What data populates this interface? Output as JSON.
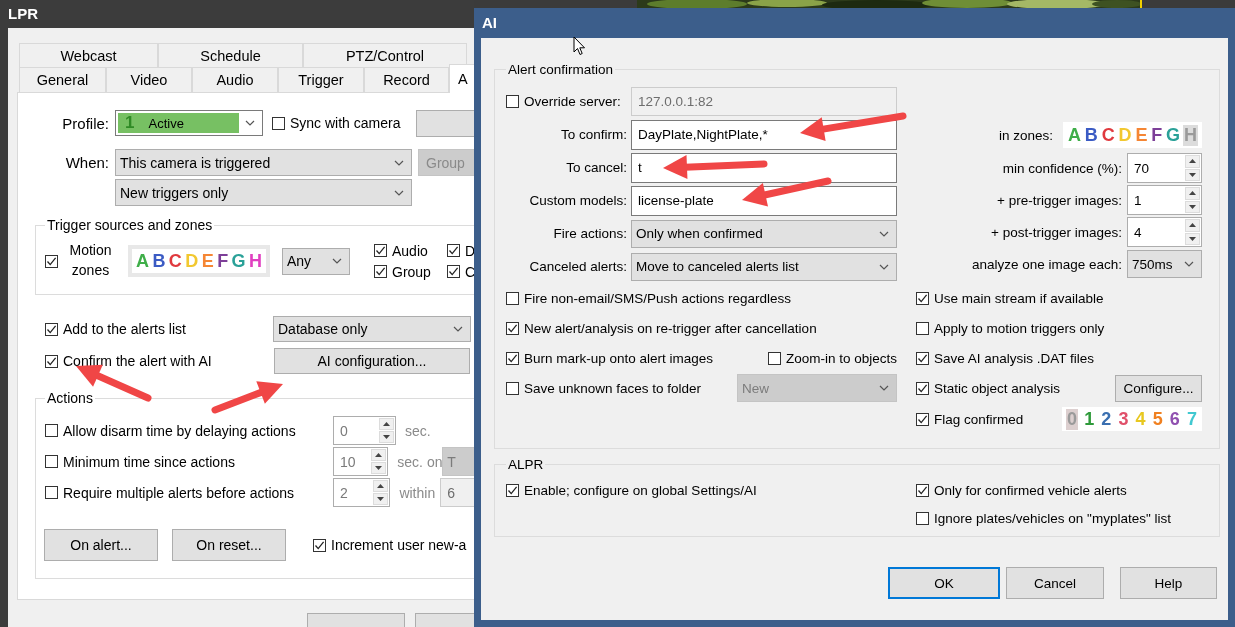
{
  "lpr_window": {
    "title": "LPR",
    "tabs_row_1": [
      {
        "label": "Webcast",
        "selected": false
      },
      {
        "label": "Schedule",
        "selected": false
      },
      {
        "label": "PTZ/Control",
        "selected": false
      }
    ],
    "tabs_row_2": [
      {
        "label": "General",
        "selected": false
      },
      {
        "label": "Video",
        "selected": false
      },
      {
        "label": "Audio",
        "selected": false
      },
      {
        "label": "Trigger",
        "selected": false
      },
      {
        "label": "Record",
        "selected": false
      },
      {
        "label": "A",
        "selected": true
      }
    ],
    "profile": {
      "label": "Profile:",
      "number": "1",
      "value": "Active"
    },
    "sync_with_camera": {
      "label": "Sync with camera",
      "checked": false
    },
    "when": {
      "label": "When:",
      "value": "This camera is triggered"
    },
    "groups_button": {
      "label": "Group",
      "disabled": true
    },
    "trigger_filter": {
      "value": "New triggers only"
    },
    "trigger_sources": {
      "title": "Trigger sources and zones",
      "motion_zones": {
        "label": "Motion zones",
        "checked": true
      },
      "zones": [
        {
          "label": "A",
          "color": "#3fae49"
        },
        {
          "label": "B",
          "color": "#3b5bc4"
        },
        {
          "label": "C",
          "color": "#e0393e"
        },
        {
          "label": "D",
          "color": "#f2c830"
        },
        {
          "label": "E",
          "color": "#f58634"
        },
        {
          "label": "F",
          "color": "#7d3f98"
        },
        {
          "label": "G",
          "color": "#2aa198"
        },
        {
          "label": "H",
          "color": "#e040c0"
        }
      ],
      "zone_match": "Any",
      "sources": [
        {
          "label": "Audio",
          "checked": true
        },
        {
          "label": "D",
          "checked": true
        },
        {
          "label": "Group",
          "checked": true
        },
        {
          "label": "C",
          "checked": true
        }
      ]
    },
    "add_to_alerts": {
      "label": "Add to the alerts list",
      "checked": true,
      "mode": "Database only"
    },
    "confirm_with_ai": {
      "label": "Confirm the alert with AI",
      "checked": true,
      "button": "AI configuration..."
    },
    "actions": {
      "title": "Actions",
      "rows": [
        {
          "label": "Allow disarm time by delaying actions",
          "checked": false,
          "value": "0",
          "unit": "sec."
        },
        {
          "label": "Minimum time since actions",
          "checked": false,
          "value": "10",
          "unit": "sec. on",
          "extra": {
            "kind": "combo",
            "value": "T"
          }
        },
        {
          "label": "Require multiple alerts before actions",
          "checked": false,
          "value": "2",
          "unit": "within",
          "extra": {
            "kind": "field",
            "value": "6"
          }
        }
      ],
      "buttons": [
        "On alert...",
        "On reset..."
      ],
      "increment": {
        "label": "Increment user new-a",
        "checked": true
      }
    }
  },
  "ai_window": {
    "title": "AI",
    "alert_confirmation": {
      "title": "Alert confirmation",
      "fields": [
        {
          "kind": "check-text",
          "label": "Override server:",
          "checked": false,
          "value": "127.0.0.1:82"
        },
        {
          "kind": "text",
          "label": "To confirm:",
          "value": "DayPlate,NightPlate,*"
        },
        {
          "kind": "text",
          "label": "To cancel:",
          "value": "t"
        },
        {
          "kind": "text",
          "label": "Custom models:",
          "value": "license-plate"
        },
        {
          "kind": "combo",
          "label": "Fire actions:",
          "value": "Only when confirmed"
        },
        {
          "kind": "combo",
          "label": "Canceled alerts:",
          "value": "Move to canceled alerts list"
        }
      ],
      "zones_label": "in zones:",
      "zones": [
        {
          "label": "A",
          "color": "#3fae49",
          "on": true
        },
        {
          "label": "B",
          "color": "#3b5bc4",
          "on": true
        },
        {
          "label": "C",
          "color": "#e0393e",
          "on": true
        },
        {
          "label": "D",
          "color": "#f2c830",
          "on": true
        },
        {
          "label": "E",
          "color": "#f58634",
          "on": true
        },
        {
          "label": "F",
          "color": "#7d3f98",
          "on": true
        },
        {
          "label": "G",
          "color": "#2aa198",
          "on": true
        },
        {
          "label": "H",
          "color": "#9a9a9a",
          "on": false
        }
      ],
      "settings": [
        {
          "kind": "spin",
          "label": "min confidence (%):",
          "value": "70"
        },
        {
          "kind": "spin",
          "label": "+ pre-trigger images:",
          "value": "1"
        },
        {
          "kind": "spin",
          "label": "+ post-trigger images:",
          "value": "4"
        },
        {
          "kind": "combo",
          "label": "analyze one image each:",
          "value": "750ms"
        }
      ],
      "options_left": [
        {
          "label": "Fire non-email/SMS/Push actions regardless",
          "checked": false
        },
        {
          "label": "New alert/analysis on re-trigger after cancellation",
          "checked": true
        },
        {
          "label": "Burn mark-up onto alert images",
          "checked": true,
          "extra": {
            "kind": "check",
            "label": "Zoom-in to objects",
            "checked": false
          }
        },
        {
          "label": "Save unknown faces to folder",
          "checked": false,
          "extra": {
            "kind": "combo",
            "value": "New"
          }
        }
      ],
      "options_right": [
        {
          "label": "Use main stream if available",
          "checked": true
        },
        {
          "label": "Apply to motion triggers only",
          "checked": false
        },
        {
          "label": "Save AI analysis .DAT files",
          "checked": true
        },
        {
          "label": "Static object analysis",
          "checked": true,
          "extra": {
            "kind": "button",
            "label": "Configure..."
          }
        },
        {
          "label": "Flag confirmed",
          "checked": true,
          "extra": {
            "kind": "flags"
          }
        }
      ],
      "flags": [
        {
          "label": "0",
          "color": "#9a9a9a",
          "selected": true
        },
        {
          "label": "1",
          "color": "#2e9a3a",
          "selected": false
        },
        {
          "label": "2",
          "color": "#3a6fb0",
          "selected": false
        },
        {
          "label": "3",
          "color": "#e0506a",
          "selected": false
        },
        {
          "label": "4",
          "color": "#e8c820",
          "selected": false
        },
        {
          "label": "5",
          "color": "#f08020",
          "selected": false
        },
        {
          "label": "6",
          "color": "#9050b0",
          "selected": false
        },
        {
          "label": "7",
          "color": "#40c8d0",
          "selected": false
        }
      ]
    },
    "alpr": {
      "title": "ALPR",
      "options_left": [
        {
          "label": "Enable; configure on global Settings/AI",
          "checked": true
        }
      ],
      "options_right": [
        {
          "label": "Only for confirmed vehicle alerts",
          "checked": true
        },
        {
          "label": "Ignore plates/vehicles on \"myplates\" list",
          "checked": false
        }
      ]
    },
    "buttons": [
      {
        "label": "OK",
        "default": true
      },
      {
        "label": "Cancel",
        "default": false
      },
      {
        "label": "Help",
        "default": false
      }
    ]
  }
}
